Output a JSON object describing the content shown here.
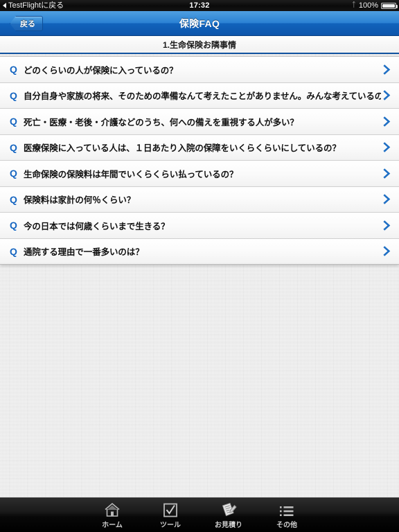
{
  "status_bar": {
    "back_label": "TestFlightに戻る",
    "time": "17:32",
    "battery_text": "100%",
    "bluetooth_icon": "bluetooth-icon",
    "battery_icon": "battery-full-icon"
  },
  "nav_bar": {
    "back_label": "戻る",
    "title": "保険FAQ"
  },
  "section": {
    "title": "1.生命保険お隣事情"
  },
  "faq": {
    "q_marker": "Q",
    "chevron_icon": "chevron-right-icon",
    "accent_color": "#1565c0",
    "items": [
      {
        "question": "どのくらいの人が保険に入っているの？"
      },
      {
        "question": "自分自身や家族の将来、そのための準備なんて考えたことがありません。みんな考えているの？"
      },
      {
        "question": "死亡・医療・老後・介護などのうち、何への備えを重視する人が多い？"
      },
      {
        "question": "医療保険に入っている人は、１日あたり入院の保障をいくらくらいにしているの？"
      },
      {
        "question": "生命保険の保険料は年間でいくらくらい払っているの？"
      },
      {
        "question": "保険料は家計の何％くらい？"
      },
      {
        "question": "今の日本では何歳くらいまで生きる？"
      },
      {
        "question": "通院する理由で一番多いのは？"
      }
    ]
  },
  "tab_bar": {
    "items": [
      {
        "label": "ホーム",
        "icon": "home-icon"
      },
      {
        "label": "ツール",
        "icon": "checkbox-checked-icon"
      },
      {
        "label": "お見積り",
        "icon": "document-pen-icon"
      },
      {
        "label": "その他",
        "icon": "bullet-list-icon"
      }
    ]
  }
}
